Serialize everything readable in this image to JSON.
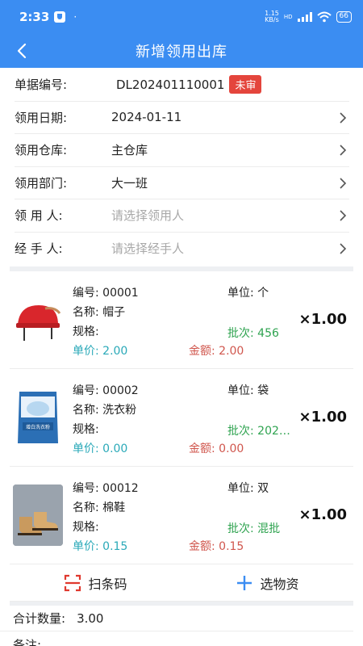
{
  "status_bar": {
    "time": "2:33",
    "dot": "·",
    "net_speed_top": "1.15",
    "net_speed_bottom": "KB/s",
    "net_type": "HD",
    "battery": "66"
  },
  "header": {
    "title": "新增领用出库",
    "back_icon": "chevron-left-icon"
  },
  "form": {
    "doc_no": {
      "label": "单据编号:",
      "value": "DL202401110001",
      "badge": "未审"
    },
    "date": {
      "label": "领用日期:",
      "value": "2024-01-11"
    },
    "warehouse": {
      "label": "领用仓库:",
      "value": "主仓库"
    },
    "department": {
      "label": "领用部门:",
      "value": "大一班"
    },
    "recipient": {
      "label": "领 用 人:",
      "placeholder": "请选择领用人"
    },
    "handler": {
      "label": "经 手 人:",
      "placeholder": "请选择经手人"
    }
  },
  "items": [
    {
      "code_label": "编号:",
      "code": "00001",
      "unit_label": "单位:",
      "unit": "个",
      "name_label": "名称:",
      "name": "帽子",
      "spec_label": "规格:",
      "batch_label": "批次:",
      "batch": "456",
      "price_label": "单价:",
      "price": "2.00",
      "amount_label": "金额:",
      "amount": "2.00",
      "qty": "×1.00",
      "image": "red-helmet"
    },
    {
      "code_label": "编号:",
      "code": "00002",
      "unit_label": "单位:",
      "unit": "袋",
      "name_label": "名称:",
      "name": "洗衣粉",
      "spec_label": "规格:",
      "batch_label": "批次:",
      "batch": "202…",
      "price_label": "单价:",
      "price": "0.00",
      "amount_label": "金额:",
      "amount": "0.00",
      "qty": "×1.00",
      "image": "detergent-bag",
      "image_text": "增白洗衣粉"
    },
    {
      "code_label": "编号:",
      "code": "00012",
      "unit_label": "单位:",
      "unit": "双",
      "name_label": "名称:",
      "name": "棉鞋",
      "spec_label": "规格:",
      "batch_label": "批次:",
      "batch": "混批",
      "price_label": "单价:",
      "price": "0.15",
      "amount_label": "金额:",
      "amount": "0.15",
      "qty": "×1.00",
      "image": "cotton-boots"
    }
  ],
  "actions": {
    "scan": "扫条码",
    "select": "选物资"
  },
  "summary": {
    "total_label": "合计数量:",
    "total_value": "3.00",
    "remark_label": "备注:"
  },
  "colors": {
    "primary": "#3b8df2",
    "badge": "#e4453c",
    "batch": "#2fa350",
    "price": "#2aa9b8",
    "amount": "#d0564d",
    "scan_icon": "#e0392f"
  }
}
